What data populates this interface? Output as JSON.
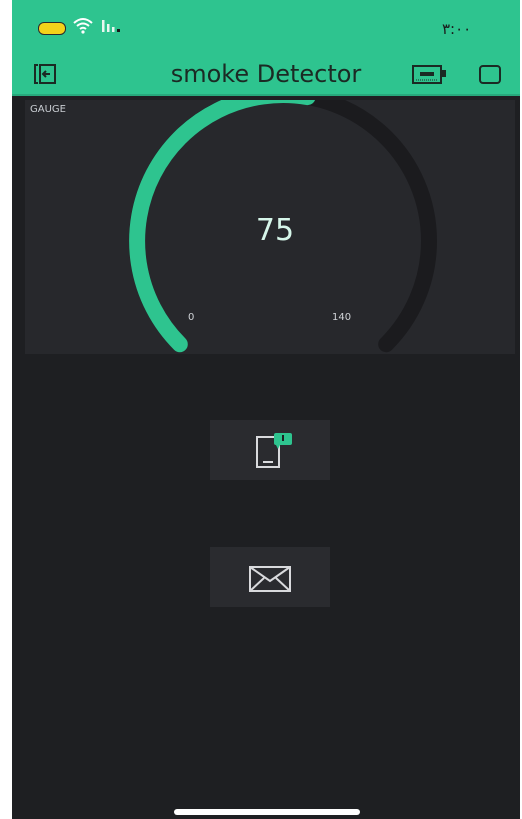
{
  "status_bar": {
    "time": "٣:٠٠",
    "icons": [
      "battery-icon",
      "wifi-icon",
      "signal-icon"
    ]
  },
  "header": {
    "title": "smoke Detector",
    "left_icon": "exit-icon",
    "right_icons": [
      "battery-device-icon",
      "square-icon"
    ]
  },
  "gauge": {
    "label": "GAUGE",
    "value": "75",
    "min": "0",
    "max": "140",
    "fraction": 0.536
  },
  "widgets": [
    {
      "icon": "device-notification-icon"
    },
    {
      "icon": "mail-icon"
    }
  ],
  "colors": {
    "accent": "#2ec48f",
    "background": "#1e1f22",
    "panel": "#27282c",
    "track": "#1b1b1e"
  }
}
